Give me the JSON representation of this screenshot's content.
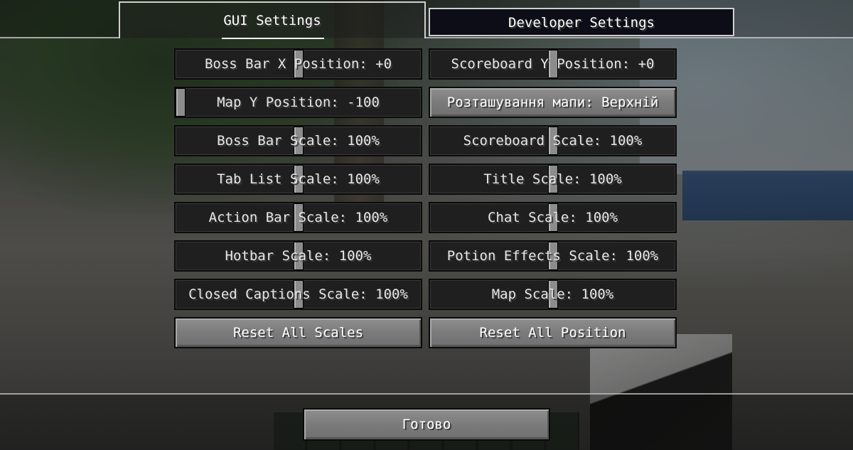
{
  "tabs": [
    {
      "label": "GUI Settings",
      "active": true
    },
    {
      "label": "Developer Settings",
      "active": false
    }
  ],
  "controls": {
    "left": [
      {
        "type": "slider",
        "label": "Boss Bar X Position: +0",
        "level": 0.5
      },
      {
        "type": "slider",
        "label": "Map Y Position: -100",
        "level": 0.0
      },
      {
        "type": "slider",
        "label": "Boss Bar Scale: 100%",
        "level": 0.5
      },
      {
        "type": "slider",
        "label": "Tab List Scale: 100%",
        "level": 0.5
      },
      {
        "type": "slider",
        "label": "Action Bar Scale: 100%",
        "level": 0.5
      },
      {
        "type": "slider",
        "label": "Hotbar Scale: 100%",
        "level": 0.5
      },
      {
        "type": "slider",
        "label": "Closed Captions Scale: 100%",
        "level": 0.5
      },
      {
        "type": "button",
        "label": "Reset All Scales"
      }
    ],
    "right": [
      {
        "type": "slider",
        "label": "Scoreboard Y Position: +0",
        "level": 0.5
      },
      {
        "type": "button",
        "label": "Розташування мапи: Верхній"
      },
      {
        "type": "slider",
        "label": "Scoreboard Scale: 100%",
        "level": 0.5
      },
      {
        "type": "slider",
        "label": "Title Scale: 100%",
        "level": 0.5
      },
      {
        "type": "slider",
        "label": "Chat Scale: 100%",
        "level": 0.5
      },
      {
        "type": "slider",
        "label": "Potion Effects Scale: 100%",
        "level": 0.5
      },
      {
        "type": "slider",
        "label": "Map Scale: 100%",
        "level": 0.5
      },
      {
        "type": "button",
        "label": "Reset All Position"
      }
    ]
  },
  "done_label": "Готово",
  "colors": {
    "slider_bg": "#1f1f1f",
    "button_bg": "#7b7b7b",
    "text": "#ffffff",
    "dev_tab_bg": "#0d0d17"
  }
}
